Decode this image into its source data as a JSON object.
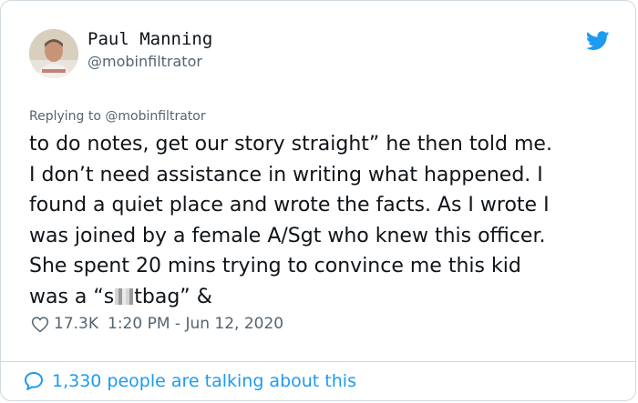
{
  "author": {
    "name": "Paul Manning",
    "handle": "@mobinfiltrator"
  },
  "reply": {
    "prefix": "Replying to",
    "handle": "@mobinfiltrator"
  },
  "tweet": {
    "lines": [
      "to do notes, get our story straight” he then told me.",
      "I don’t need assistance in writing what happened. I",
      "found a quiet place and wrote the facts. As I wrote I",
      "was joined by a female A/Sgt who knew this officer.",
      "She spent 20 mins trying to convince me this kid"
    ],
    "last_line_before": "was a “s",
    "last_line_after": "tbag” &"
  },
  "stats": {
    "likes": "17.3K",
    "timestamp": "1:20 PM - Jun 12, 2020"
  },
  "footer": {
    "talking": "1,330 people are talking about this"
  },
  "colors": {
    "accent": "#1d9bf0",
    "secondary_text": "#536471",
    "border": "#cfd9de"
  }
}
